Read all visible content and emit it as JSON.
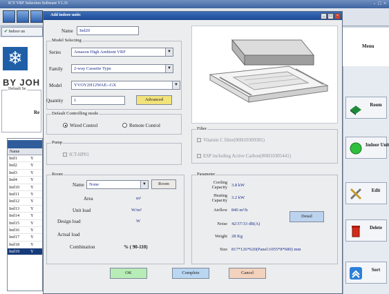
{
  "app": {
    "title": "ICY VRF Selection Software  V1.31",
    "window_controls": "- □ ×",
    "tab_label": "Indoor un",
    "brand_text": "BY JOH",
    "defaults_label": "Default Se",
    "defaults_frag": "Re",
    "menu_label": "Menu",
    "list": {
      "column": "Name",
      "rows": [
        {
          "name": "Ind1",
          "flag": "Y"
        },
        {
          "name": "Ind2",
          "flag": "Y"
        },
        {
          "name": "Ind3",
          "flag": "Y"
        },
        {
          "name": "Ind4",
          "flag": "Y"
        },
        {
          "name": "Ind10",
          "flag": "Y"
        },
        {
          "name": "Ind11",
          "flag": "Y"
        },
        {
          "name": "Ind12",
          "flag": "Y"
        },
        {
          "name": "Ind13",
          "flag": "Y"
        },
        {
          "name": "Ind14",
          "flag": "Y"
        },
        {
          "name": "Ind15",
          "flag": "Y"
        },
        {
          "name": "Ind16",
          "flag": "Y"
        },
        {
          "name": "Ind17",
          "flag": "Y"
        },
        {
          "name": "Ind18",
          "flag": "Y"
        },
        {
          "name": "Ind19",
          "flag": "Y"
        }
      ]
    },
    "side_buttons": {
      "room": "Room",
      "indoor_units": "Indoor Units",
      "edit": "Edit",
      "delete": "Delete",
      "sort": "Sort"
    }
  },
  "dialog": {
    "title": "Add indoor units",
    "controls": {
      "min": "_",
      "max": "□",
      "close": "×"
    },
    "name_label": "Name",
    "name_value": "Ind20",
    "model_group": "Model Selecting",
    "series_label": "Series",
    "series_value": "Amazon High Ambient VRF",
    "family_label": "Family",
    "family_value": "2-way Cassette Type",
    "model_label": "Model",
    "model_value": "YVOY2H12WAE--GX",
    "quantity_label": "Quantity",
    "quantity_value": "1",
    "advanced": "Advanced",
    "control_group": "Default Controlling mode",
    "wired": "Wired Control",
    "remote": "Remote Control",
    "pump_group": "Pump",
    "pump_option": "ICT-HP01",
    "filter_group": "Filter",
    "filter_1": "Vitamin C filter(00H10309381)",
    "filter_2": "ESP including Active Carbon(00H10305441)",
    "room_group": "Room",
    "room_name_label": "Name",
    "room_name_value": "None",
    "room_button": "Room",
    "area_label": "Area",
    "area_unit": "m²",
    "unit_load_label": "Unit load",
    "unit_load_unit": "W/m²",
    "design_load_label": "Design load",
    "design_load_unit": "W",
    "actual_load_label": "Actual load",
    "combination_label": "Combination",
    "combination_value": "%  ( 90-110)",
    "param_group": "Parameter",
    "cooling_label": "Cooling Capacity",
    "cooling_value": "3.8 kW",
    "heating_label": "Heating Capacity",
    "heating_value": "3.2 kW",
    "airflow_label": "Airflow",
    "airflow_value": "840 m³/h",
    "detail": "Detail",
    "noise_label": "Noise",
    "noise_value": "42/37/33 dB(A)",
    "weight_label": "Weight",
    "weight_value": "28 Kg",
    "size_label": "Size",
    "size_value": "817*126*620(Panel:1055*8*680) mm",
    "ok": "OK",
    "complete": "Complete",
    "cancel": "Cancel"
  },
  "colors": {
    "ok": "#b7ecb7",
    "complete": "#b9d6f2",
    "cancel": "#f3d2bd",
    "advanced": "#f2e27a",
    "detail": "#bcd3ef"
  }
}
